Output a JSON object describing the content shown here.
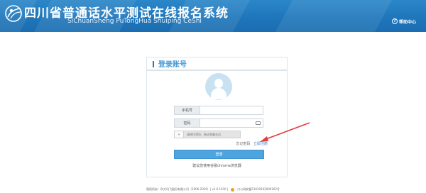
{
  "header": {
    "title": "四川省普通话水平测试在线报名系统",
    "subtitle": "SiChuanSheng PuTongHua Shuiping CeShi",
    "help_label": "帮助中心",
    "help_icon": "question-circle-icon"
  },
  "login": {
    "title": "登录账号",
    "avatar_icon": "user-avatar-icon",
    "phone_label": "手机号",
    "phone_value": "",
    "password_label": "密码",
    "password_value": "",
    "password_icon": "keyboard-icon",
    "slider_knob": "»",
    "slider_text": "请按住滑块，拖动到最右边",
    "forgot_label": "忘记密码",
    "register_label": "立即注册",
    "login_button": "登录",
    "browser_tip": "建议您使用谷歌chrome浏览器"
  },
  "footer": {
    "copyright": "版权所有：科大讯飞股份有限公司（2006-2020）| v1.0.1030 |",
    "record": "川公网安备51010202000162号",
    "badge_icon": "police-badge-icon"
  },
  "colors": {
    "header_blue": "#1f76bb",
    "accent_blue": "#4ea4df",
    "annotation_red": "#e23d3d"
  }
}
